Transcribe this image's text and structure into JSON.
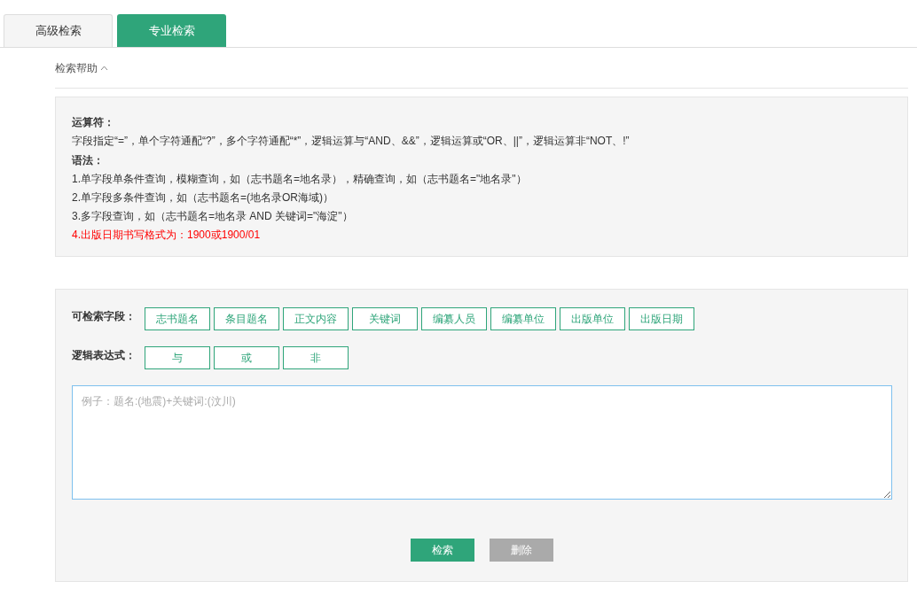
{
  "tabs": [
    {
      "label": "高级检索",
      "selected": false
    },
    {
      "label": "专业检索",
      "selected": true
    }
  ],
  "help": {
    "label": "检索帮助",
    "expanded": true,
    "lines": [
      {
        "kind": "heading",
        "text": "运算符："
      },
      {
        "kind": "text",
        "text": "字段指定“=”，单个字符通配“?”，多个字符通配“*”，逻辑运算与“AND、&&”，逻辑运算或“OR、||”，逻辑运算非“NOT、!”"
      },
      {
        "kind": "heading",
        "text": "语法："
      },
      {
        "kind": "text",
        "text": "1.单字段单条件查询，模糊查询，如（志书题名=地名录），精确查询，如（志书题名=\"地名录\"）"
      },
      {
        "kind": "text",
        "text": "2.单字段多条件查询，如（志书题名=(地名录OR海域)）"
      },
      {
        "kind": "text",
        "text": "3.多字段查询，如（志书题名=地名录 AND 关键词=\"海淀\"）"
      },
      {
        "kind": "warning",
        "text": "4.出版日期书写格式为：1900或1900/01"
      }
    ]
  },
  "fields": {
    "label": "可检索字段：",
    "buttons": [
      "志书题名",
      "条目题名",
      "正文内容",
      "关键词",
      "编纂人员",
      "编纂单位",
      "出版单位",
      "出版日期"
    ]
  },
  "logic": {
    "label": "逻辑表达式：",
    "buttons": [
      "与",
      "或",
      "非"
    ]
  },
  "query": {
    "placeholder": "例子：题名:(地震)+关键词:(汶川)"
  },
  "actions": [
    {
      "kind": "primary",
      "label": "检索"
    },
    {
      "kind": "secondary",
      "label": "删除"
    }
  ]
}
